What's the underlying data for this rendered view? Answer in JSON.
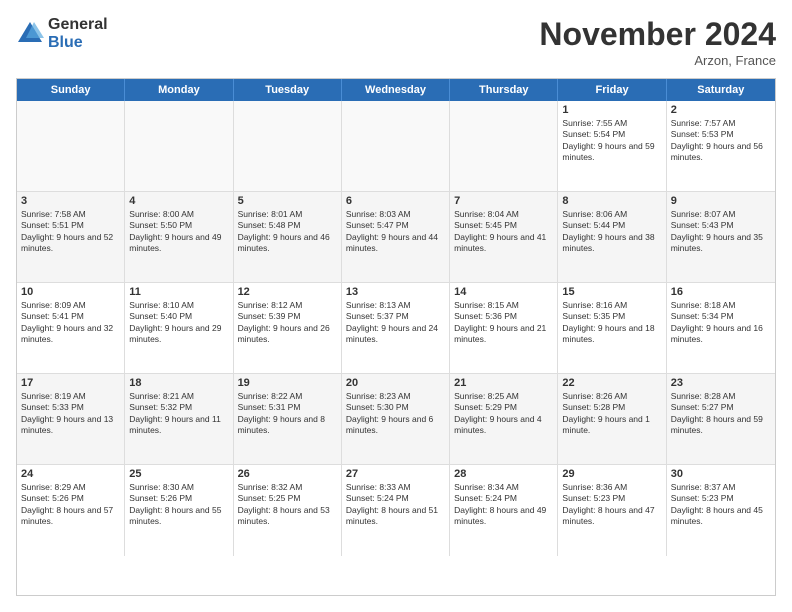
{
  "logo": {
    "general": "General",
    "blue": "Blue"
  },
  "title": "November 2024",
  "location": "Arzon, France",
  "header_days": [
    "Sunday",
    "Monday",
    "Tuesday",
    "Wednesday",
    "Thursday",
    "Friday",
    "Saturday"
  ],
  "rows": [
    [
      {
        "day": "",
        "content": ""
      },
      {
        "day": "",
        "content": ""
      },
      {
        "day": "",
        "content": ""
      },
      {
        "day": "",
        "content": ""
      },
      {
        "day": "",
        "content": ""
      },
      {
        "day": "1",
        "content": "Sunrise: 7:55 AM\nSunset: 5:54 PM\nDaylight: 9 hours and 59 minutes."
      },
      {
        "day": "2",
        "content": "Sunrise: 7:57 AM\nSunset: 5:53 PM\nDaylight: 9 hours and 56 minutes."
      }
    ],
    [
      {
        "day": "3",
        "content": "Sunrise: 7:58 AM\nSunset: 5:51 PM\nDaylight: 9 hours and 52 minutes."
      },
      {
        "day": "4",
        "content": "Sunrise: 8:00 AM\nSunset: 5:50 PM\nDaylight: 9 hours and 49 minutes."
      },
      {
        "day": "5",
        "content": "Sunrise: 8:01 AM\nSunset: 5:48 PM\nDaylight: 9 hours and 46 minutes."
      },
      {
        "day": "6",
        "content": "Sunrise: 8:03 AM\nSunset: 5:47 PM\nDaylight: 9 hours and 44 minutes."
      },
      {
        "day": "7",
        "content": "Sunrise: 8:04 AM\nSunset: 5:45 PM\nDaylight: 9 hours and 41 minutes."
      },
      {
        "day": "8",
        "content": "Sunrise: 8:06 AM\nSunset: 5:44 PM\nDaylight: 9 hours and 38 minutes."
      },
      {
        "day": "9",
        "content": "Sunrise: 8:07 AM\nSunset: 5:43 PM\nDaylight: 9 hours and 35 minutes."
      }
    ],
    [
      {
        "day": "10",
        "content": "Sunrise: 8:09 AM\nSunset: 5:41 PM\nDaylight: 9 hours and 32 minutes."
      },
      {
        "day": "11",
        "content": "Sunrise: 8:10 AM\nSunset: 5:40 PM\nDaylight: 9 hours and 29 minutes."
      },
      {
        "day": "12",
        "content": "Sunrise: 8:12 AM\nSunset: 5:39 PM\nDaylight: 9 hours and 26 minutes."
      },
      {
        "day": "13",
        "content": "Sunrise: 8:13 AM\nSunset: 5:37 PM\nDaylight: 9 hours and 24 minutes."
      },
      {
        "day": "14",
        "content": "Sunrise: 8:15 AM\nSunset: 5:36 PM\nDaylight: 9 hours and 21 minutes."
      },
      {
        "day": "15",
        "content": "Sunrise: 8:16 AM\nSunset: 5:35 PM\nDaylight: 9 hours and 18 minutes."
      },
      {
        "day": "16",
        "content": "Sunrise: 8:18 AM\nSunset: 5:34 PM\nDaylight: 9 hours and 16 minutes."
      }
    ],
    [
      {
        "day": "17",
        "content": "Sunrise: 8:19 AM\nSunset: 5:33 PM\nDaylight: 9 hours and 13 minutes."
      },
      {
        "day": "18",
        "content": "Sunrise: 8:21 AM\nSunset: 5:32 PM\nDaylight: 9 hours and 11 minutes."
      },
      {
        "day": "19",
        "content": "Sunrise: 8:22 AM\nSunset: 5:31 PM\nDaylight: 9 hours and 8 minutes."
      },
      {
        "day": "20",
        "content": "Sunrise: 8:23 AM\nSunset: 5:30 PM\nDaylight: 9 hours and 6 minutes."
      },
      {
        "day": "21",
        "content": "Sunrise: 8:25 AM\nSunset: 5:29 PM\nDaylight: 9 hours and 4 minutes."
      },
      {
        "day": "22",
        "content": "Sunrise: 8:26 AM\nSunset: 5:28 PM\nDaylight: 9 hours and 1 minute."
      },
      {
        "day": "23",
        "content": "Sunrise: 8:28 AM\nSunset: 5:27 PM\nDaylight: 8 hours and 59 minutes."
      }
    ],
    [
      {
        "day": "24",
        "content": "Sunrise: 8:29 AM\nSunset: 5:26 PM\nDaylight: 8 hours and 57 minutes."
      },
      {
        "day": "25",
        "content": "Sunrise: 8:30 AM\nSunset: 5:26 PM\nDaylight: 8 hours and 55 minutes."
      },
      {
        "day": "26",
        "content": "Sunrise: 8:32 AM\nSunset: 5:25 PM\nDaylight: 8 hours and 53 minutes."
      },
      {
        "day": "27",
        "content": "Sunrise: 8:33 AM\nSunset: 5:24 PM\nDaylight: 8 hours and 51 minutes."
      },
      {
        "day": "28",
        "content": "Sunrise: 8:34 AM\nSunset: 5:24 PM\nDaylight: 8 hours and 49 minutes."
      },
      {
        "day": "29",
        "content": "Sunrise: 8:36 AM\nSunset: 5:23 PM\nDaylight: 8 hours and 47 minutes."
      },
      {
        "day": "30",
        "content": "Sunrise: 8:37 AM\nSunset: 5:23 PM\nDaylight: 8 hours and 45 minutes."
      }
    ]
  ]
}
